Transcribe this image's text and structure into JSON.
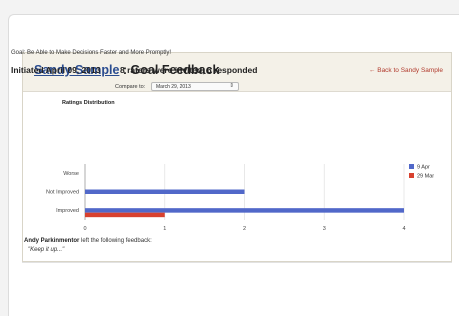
{
  "header": {
    "user_name": "Sandy Sample",
    "title_rest": " : Goal Feedback",
    "back_link": "← Back to Sandy Sample"
  },
  "goal": {
    "text": "Goal: Be Able to Make Decisions Faster and More Promptly!",
    "initiated": "Initiated April 09, 2013",
    "raters": "8 raters were invited, 6 responded"
  },
  "compare": {
    "label": "Compare to:",
    "selected": "March 29, 2013"
  },
  "chart_data": {
    "type": "bar",
    "title": "Ratings Distribution",
    "orientation": "horizontal",
    "categories": [
      "Worse",
      "Not Improved",
      "Improved"
    ],
    "series": [
      {
        "name": "9 Apr",
        "color": "#5168c9",
        "values": [
          0,
          2,
          4
        ]
      },
      {
        "name": "29 Mar",
        "color": "#d8412f",
        "values": [
          0,
          0,
          1
        ]
      }
    ],
    "x_ticks": [
      "0",
      "1",
      "2",
      "3",
      "4"
    ],
    "xlim": [
      0,
      4
    ],
    "grid": true,
    "legend": "top-right"
  },
  "feedback": {
    "author": "Andy Parkinmentor",
    "text": " left the following feedback:",
    "quote": "\"Keep it up...\""
  }
}
